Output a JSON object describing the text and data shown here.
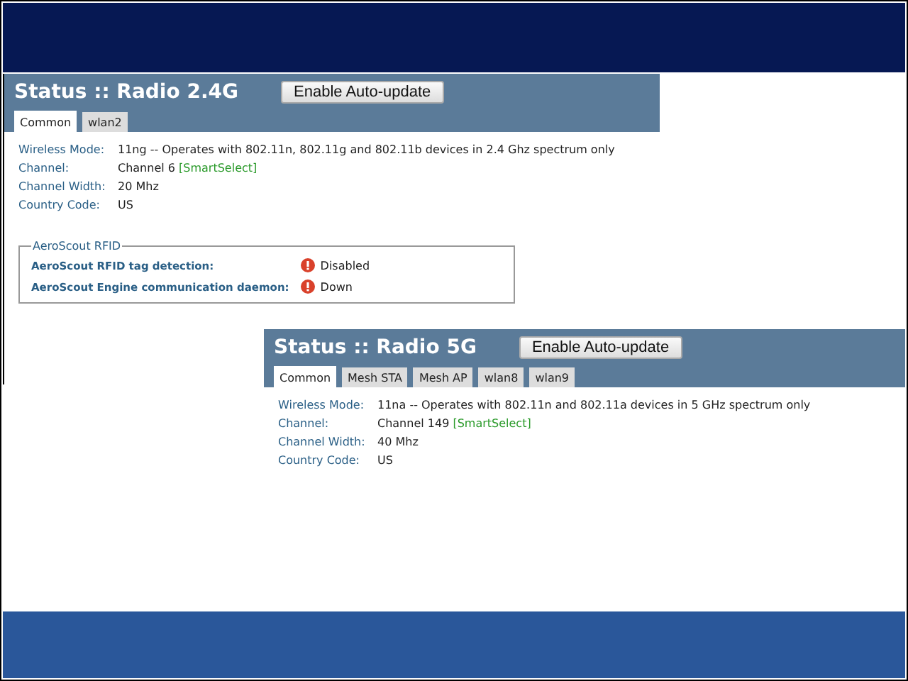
{
  "panels": [
    {
      "title": "Status :: Radio 2.4G",
      "button": "Enable Auto-update",
      "tabs": [
        {
          "label": "Common",
          "selected": true
        },
        {
          "label": "wlan2",
          "selected": false
        }
      ],
      "fields": [
        {
          "label": "Wireless Mode:",
          "value": "11ng -- Operates with 802.11n, 802.11g and 802.11b devices in 2.4 Ghz spectrum only"
        },
        {
          "label": "Channel:",
          "value": "Channel 6",
          "tag": "[SmartSelect]"
        },
        {
          "label": "Channel Width:",
          "value": "20 Mhz"
        },
        {
          "label": "Country Code:",
          "value": "US"
        }
      ],
      "group": {
        "legend": "AeroScout RFID",
        "rows": [
          {
            "label": "AeroScout RFID tag detection:",
            "status": "Disabled",
            "kind": "error"
          },
          {
            "label": "AeroScout Engine communication daemon:",
            "status": "Down",
            "kind": "error"
          }
        ]
      }
    },
    {
      "title": "Status :: Radio 5G",
      "button": "Enable Auto-update",
      "tabs": [
        {
          "label": "Common",
          "selected": true
        },
        {
          "label": "Mesh STA",
          "selected": false
        },
        {
          "label": "Mesh AP",
          "selected": false
        },
        {
          "label": "wlan8",
          "selected": false
        },
        {
          "label": "wlan9",
          "selected": false
        }
      ],
      "fields": [
        {
          "label": "Wireless Mode:",
          "value": "11na -- Operates with 802.11n and 802.11a devices in 5 GHz spectrum only"
        },
        {
          "label": "Channel:",
          "value": "Channel 149",
          "tag": "[SmartSelect]"
        },
        {
          "label": "Channel Width:",
          "value": "40 Mhz"
        },
        {
          "label": "Country Code:",
          "value": "US"
        }
      ]
    }
  ]
}
